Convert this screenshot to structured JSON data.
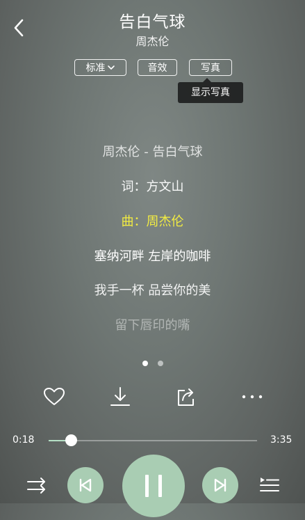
{
  "header": {
    "title": "告白气球",
    "artist": "周杰伦"
  },
  "options": {
    "quality_label": "标准",
    "effect_label": "音效",
    "photo_label": "写真",
    "tooltip": "显示写真"
  },
  "lyrics": [
    "周杰伦 - 告白气球",
    "词：方文山",
    "曲：周杰伦",
    "塞纳河畔 左岸的咖啡",
    "我手一杯 品尝你的美",
    "留下唇印的嘴"
  ],
  "current_lyric_index": 2,
  "pager": {
    "pages": 2,
    "current": 1
  },
  "actions": [
    "heart-icon",
    "download-icon",
    "share-icon",
    "more-icon"
  ],
  "progress": {
    "current_time": "0:18",
    "total_time": "3:35",
    "fraction": 0.108
  },
  "colors": {
    "accent": "#a9cdb3",
    "current_lyric": "#f2ec42",
    "progress_fill": "#b5e0c6"
  }
}
